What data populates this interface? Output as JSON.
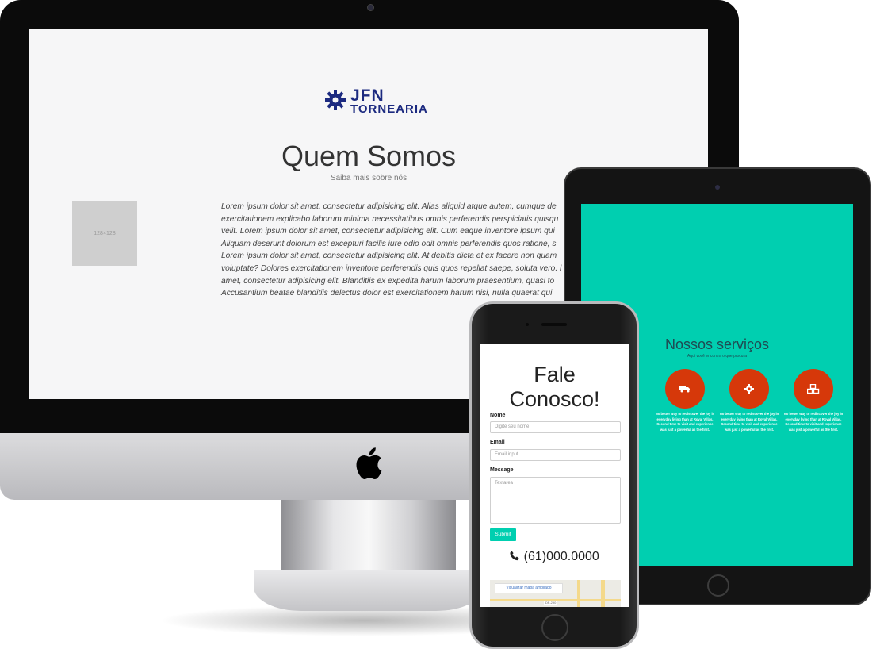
{
  "desktop": {
    "logo": {
      "line1": "JFN",
      "line2": "TORNEARIA"
    },
    "title": "Quem Somos",
    "subtitle": "Saiba mais sobre nós",
    "image_placeholder": "128×128",
    "paragraph_lines": [
      "Lorem ipsum dolor sit amet, consectetur adipisicing elit. Alias aliquid atque autem, cumque de",
      "exercitationem explicabo laborum minima necessitatibus omnis perferendis perspiciatis quisqu",
      "velit. Lorem ipsum dolor sit amet, consectetur adipisicing elit. Cum eaque inventore ipsum qui",
      "Aliquam deserunt dolorum est excepturi facilis iure odio odit omnis perferendis quos ratione, s",
      "Lorem ipsum dolor sit amet, consectetur adipisicing elit. At debitis dicta et ex facere non quam",
      "voluptate? Dolores exercitationem inventore perferendis quis quos repellat saepe, soluta vero. l",
      "amet, consectetur adipisicing elit. Blanditiis ex expedita harum laborum praesentium, quasi to",
      "Accusantium beatae blanditiis delectus dolor est exercitationem harum nisi, nulla quaerat qui"
    ]
  },
  "tablet": {
    "title": "Nossos serviços",
    "subtitle": "Aqui você encontra o que procura",
    "service_text": "No better way to rediscover the joy in everyday living than at Royal Villas. Second time to visit and experience was just a powerful as the first.",
    "service_text_partial": "the joy in Royal Villas. experience he first.",
    "services": [
      {
        "icon": "partial-circle"
      },
      {
        "icon": "truck-icon"
      },
      {
        "icon": "gear-icon"
      },
      {
        "icon": "cubes-icon"
      }
    ],
    "accent_color": "#00cfb0",
    "circle_color": "#d6380a"
  },
  "phone": {
    "title_line1": "Fale",
    "title_line2": "Conosco!",
    "fields": {
      "name_label": "Nome",
      "name_placeholder": "Digite seu nome",
      "email_label": "Email",
      "email_placeholder": "Email input",
      "message_label": "Message",
      "message_placeholder": "Textarea"
    },
    "submit_label": "Submit",
    "phone_number": "(61)000.0000",
    "map_button": "Visualizar mapa ampliado",
    "map_tag": "DF-290"
  }
}
